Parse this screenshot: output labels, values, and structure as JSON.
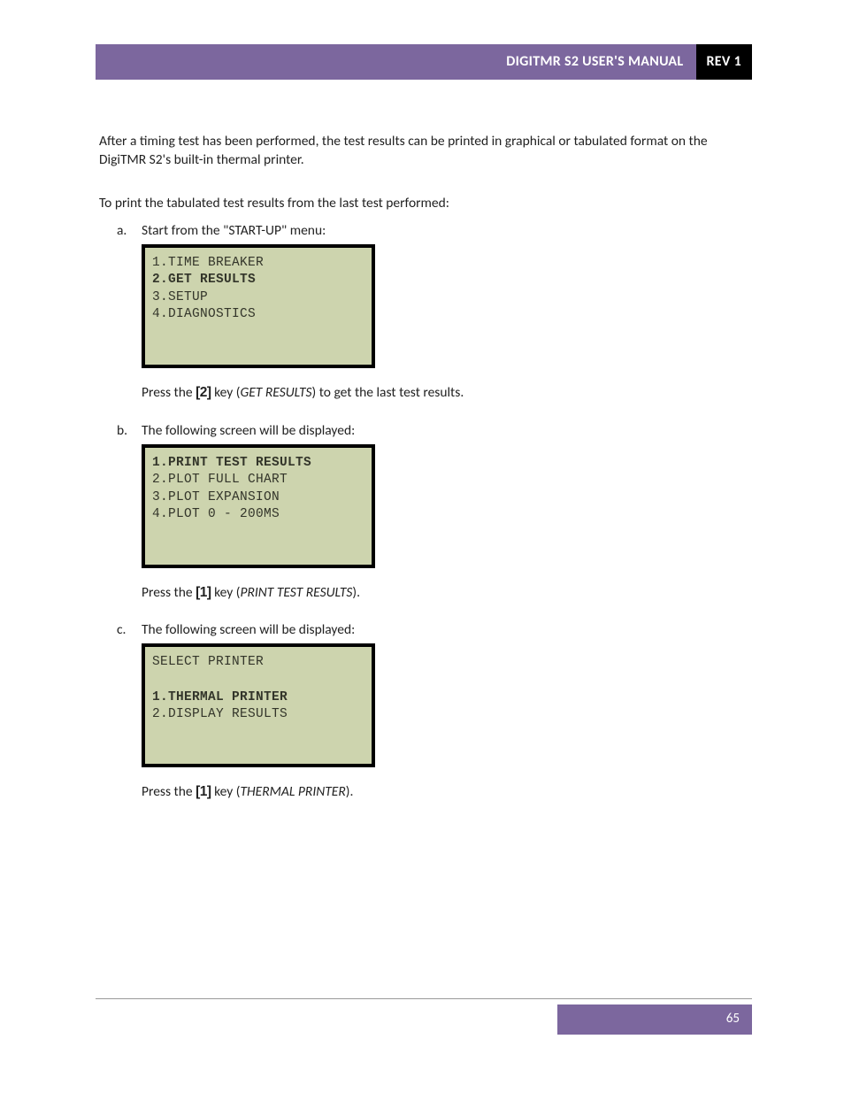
{
  "header": {
    "title": "DIGITMR S2 USER'S MANUAL",
    "rev": "REV 1"
  },
  "intro": "After a timing test has been performed, the test results can be printed in graphical or tabulated format on the DigiTMR S2's built-in thermal printer.",
  "lead": "To print the tabulated test results from the last test performed:",
  "steps": {
    "a": {
      "marker": "a.",
      "prompt": "Start from the \"START-UP\" menu:",
      "lcd": {
        "l1": "1.TIME BREAKER",
        "l2": "2.GET RESULTS",
        "l3": "3.SETUP",
        "l4": "4.DIAGNOSTICS"
      },
      "after_pre": "Press the ",
      "after_key": "[2]",
      "after_mid": " key (",
      "after_ital": "GET RESULTS",
      "after_post": ") to get the last test results."
    },
    "b": {
      "marker": "b.",
      "prompt": "The following screen will be displayed:",
      "lcd": {
        "l1": "1.PRINT TEST RESULTS",
        "l2": "2.PLOT FULL CHART",
        "l3": "3.PLOT EXPANSION",
        "l4": "4.PLOT 0 - 200MS"
      },
      "after_pre": "Press the ",
      "after_key": "[1]",
      "after_mid": " key (",
      "after_ital": "PRINT TEST RESULTS",
      "after_post": ")."
    },
    "c": {
      "marker": "c.",
      "prompt": "The following screen will be displayed:",
      "lcd": {
        "l1": "SELECT PRINTER",
        "l2": "",
        "l3": "1.THERMAL PRINTER",
        "l4": "2.DISPLAY RESULTS"
      },
      "after_pre": "Press the ",
      "after_key": "[1]",
      "after_mid": " key (",
      "after_ital": "THERMAL PRINTER",
      "after_post": ")."
    }
  },
  "footer": {
    "page": "65"
  }
}
